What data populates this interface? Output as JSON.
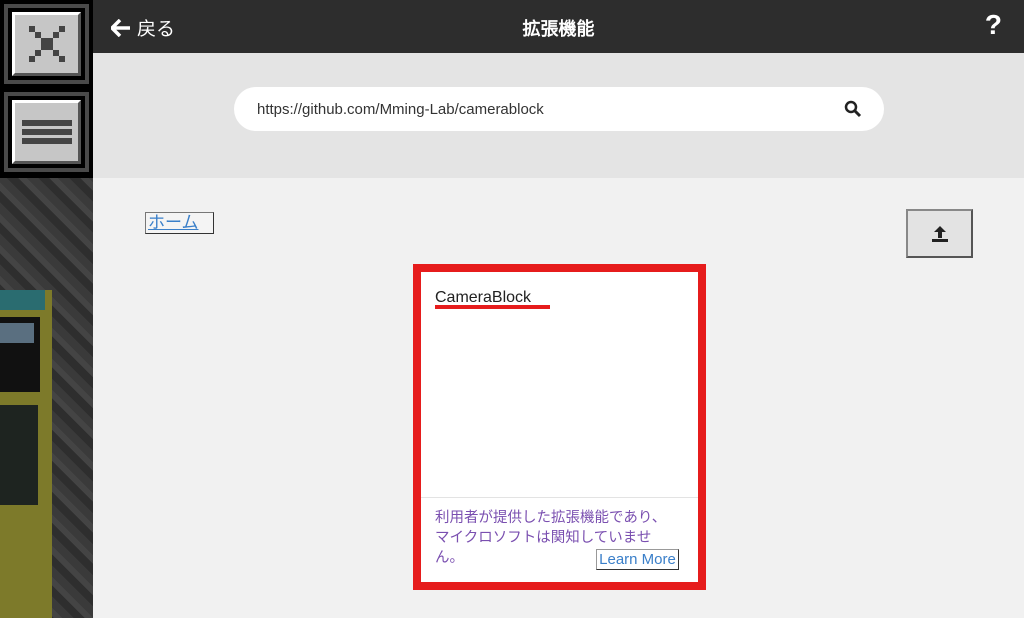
{
  "header": {
    "back_label": "戻る",
    "title": "拡張機能",
    "help_label": "?"
  },
  "search": {
    "value": "https://github.com/Mming-Lab/camerablock"
  },
  "breadcrumb": {
    "home_label": "ホーム"
  },
  "extension_card": {
    "name": "CameraBlock",
    "description": "利用者が提供した拡張機能であり、マイクロソフトは関知していません。",
    "learn_more_label": "Learn More"
  },
  "colors": {
    "highlight": "#e61c1c",
    "header_bg": "#2d2d2d"
  }
}
